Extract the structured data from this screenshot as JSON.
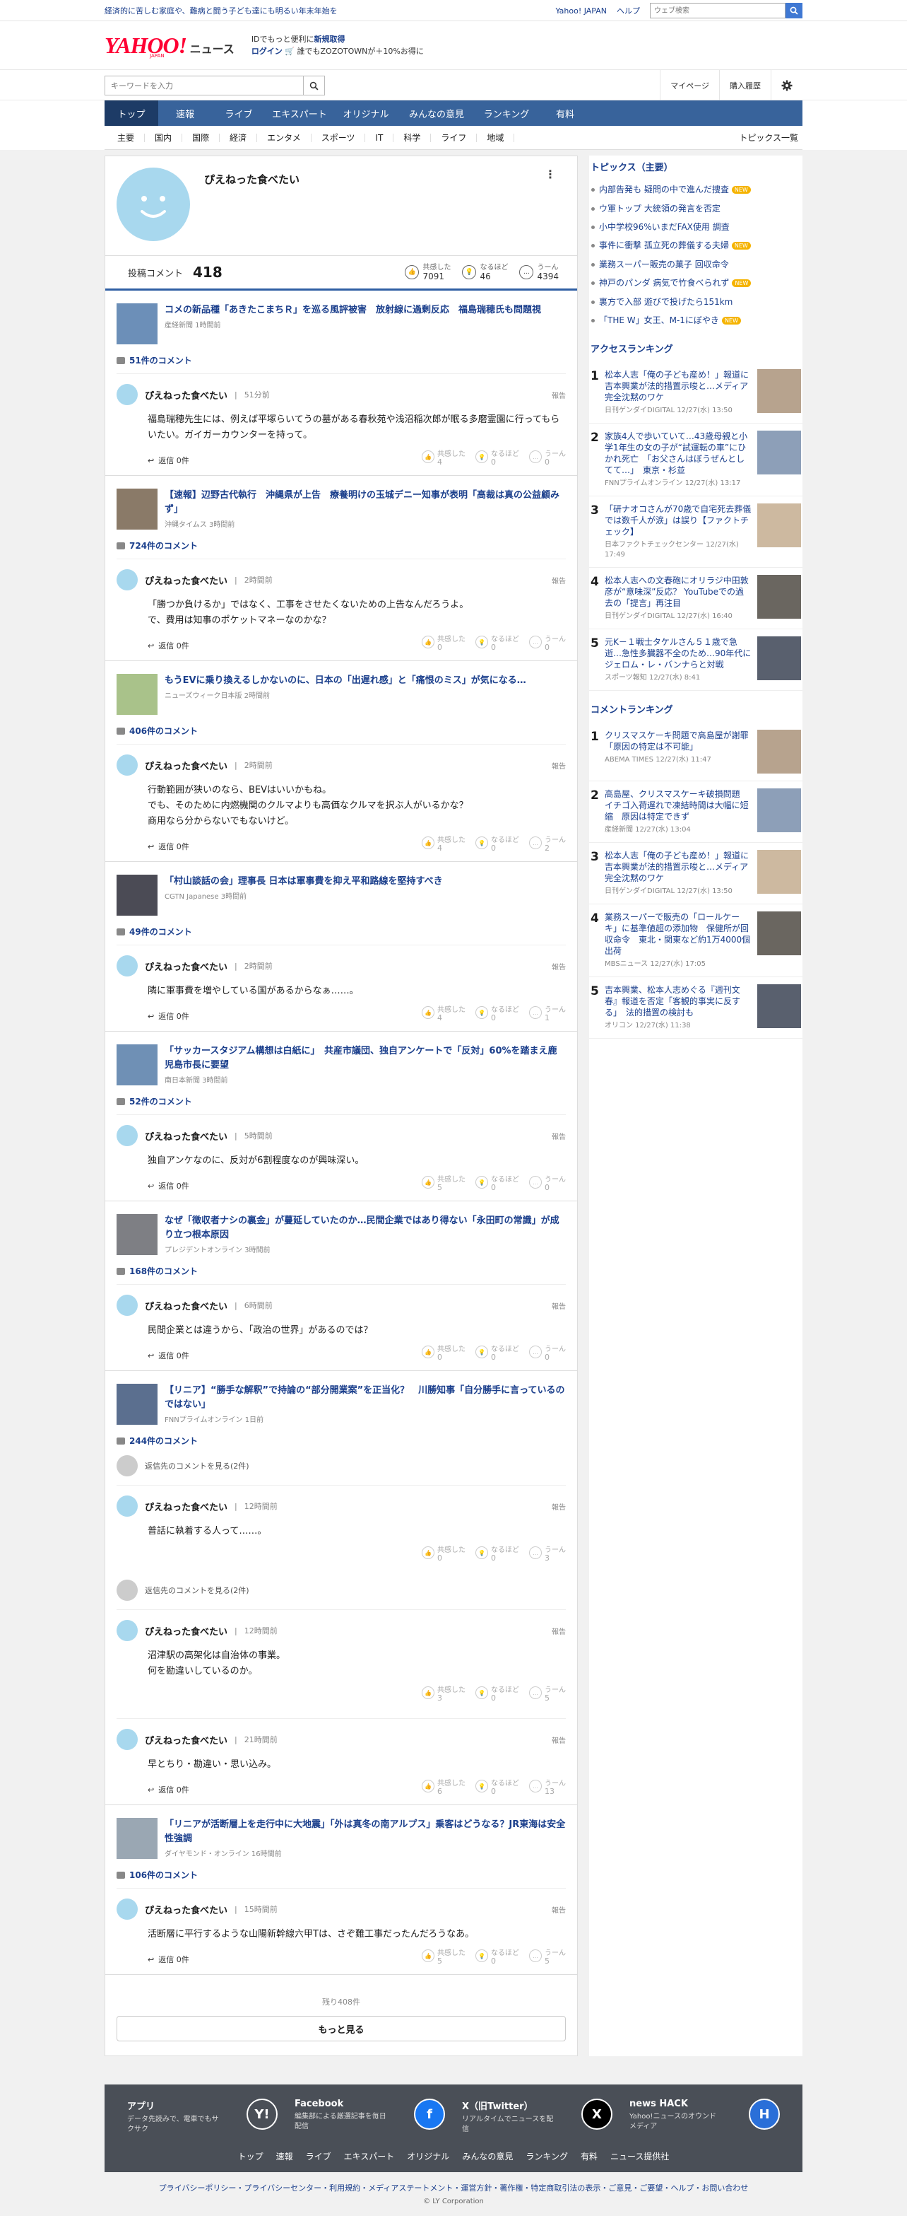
{
  "topstrip": {
    "promo": "経済的に苦しむ家庭や、難病と闘う子ども達にも明るい年末年始を",
    "links": [
      "Yahoo! JAPAN",
      "ヘルプ"
    ],
    "search_placeholder": "ウェブ検索"
  },
  "header": {
    "logo": "YAHOO!",
    "logo_sub": "JAPAN",
    "logo_news": "ニュース",
    "id_line1_a": "IDでもっと便利に",
    "id_line1_b": "新規取得",
    "id_line2_a": "ログイン",
    "id_line2_b": "🛒 誰でもZOZOTOWNが＋10%お得に"
  },
  "searchrow": {
    "placeholder": "キーワードを入力",
    "mypage": "マイページ",
    "purchase": "購入履歴"
  },
  "nav": {
    "tabs": [
      "トップ",
      "速報",
      "ライブ",
      "エキスパート",
      "オリジナル",
      "みんなの意見",
      "ランキング",
      "有料"
    ],
    "sub": [
      "主要",
      "国内",
      "国際",
      "経済",
      "エンタメ",
      "スポーツ",
      "IT",
      "科学",
      "ライフ",
      "地域"
    ],
    "sub_all": "トピックス一覧"
  },
  "profile": {
    "name": "ぴえねった食べたい",
    "post_label": "投稿コメント",
    "post_count": "418",
    "reactions": [
      {
        "label": "共感した",
        "count": "7091"
      },
      {
        "label": "なるほど",
        "count": "46"
      },
      {
        "label": "うーん",
        "count": "4394"
      }
    ]
  },
  "articles": [
    {
      "title": "コメの新品種「あきたこまちＲ」を巡る風評被害　放射線に過剰反応　福島瑞穂氏も問題視",
      "source": "産経新聞 1時間前",
      "comments_count": "51件のコメント",
      "comments": [
        {
          "user": "ぴえねった食べたい",
          "time": "51分前",
          "body": "福島瑞穂先生には、例えば平塚らいてうの墓がある春秋苑や浅沼稲次郎が眠る多磨霊園に行ってもらいたい。ガイガーカウンターを持って。",
          "reply": "返信 0件",
          "r": [
            "4",
            "0",
            "0"
          ]
        }
      ]
    },
    {
      "title": "【速報】辺野古代執行　沖縄県が上告　療養明けの玉城デニー知事が表明「高裁は真の公益顧みず」",
      "source": "沖縄タイムス 3時間前",
      "comments_count": "724件のコメント",
      "comments": [
        {
          "user": "ぴえねった食べたい",
          "time": "2時間前",
          "body": "「勝つか負けるか」ではなく、工事をさせたくないための上告なんだろうよ。\nで、費用は知事のポケットマネーなのかな？",
          "reply": "返信 0件",
          "r": [
            "0",
            "0",
            "0"
          ]
        }
      ]
    },
    {
      "title": "もうEVに乗り換えるしかないのに、日本の「出遅れ感」と「痛恨のミス」が気になる…",
      "source": "ニューズウィーク日本版 2時間前",
      "comments_count": "406件のコメント",
      "comments": [
        {
          "user": "ぴえねった食べたい",
          "time": "2時間前",
          "body": "行動範囲が狭いのなら、BEVはいいかもね。\nでも、そのために内燃機関のクルマよりも高価なクルマを択ぶ人がいるかな？\n商用なら分からないでもないけど。",
          "reply": "返信 0件",
          "r": [
            "4",
            "0",
            "2"
          ]
        }
      ]
    },
    {
      "title": "「村山談話の会」理事長 日本は軍事費を抑え平和路線を堅持すべき",
      "source": "CGTN Japanese 3時間前",
      "comments_count": "49件のコメント",
      "comments": [
        {
          "user": "ぴえねった食べたい",
          "time": "2時間前",
          "body": "隣に軍事費を増やしている国があるからなぁ……。",
          "reply": "返信 0件",
          "r": [
            "4",
            "0",
            "1"
          ]
        }
      ]
    },
    {
      "title": "「サッカースタジアム構想は白紙に」　共産市議団、独自アンケートで「反対」60%を踏まえ鹿児島市長に要望",
      "source": "南日本新聞 3時間前",
      "comments_count": "52件のコメント",
      "comments": [
        {
          "user": "ぴえねった食べたい",
          "time": "5時間前",
          "body": "独自アンケなのに、反対が6割程度なのが興味深い。",
          "reply": "返信 0件",
          "r": [
            "5",
            "0",
            "0"
          ]
        }
      ]
    },
    {
      "title": "なぜ「徴収者ナシの裏金」が蔓延していたのか…民間企業ではあり得ない「永田町の常識」が成り立つ根本原因",
      "source": "プレジデントオンライン 3時間前",
      "comments_count": "168件のコメント",
      "comments": [
        {
          "user": "ぴえねった食べたい",
          "time": "6時間前",
          "body": "民間企業とは違うから、「政治の世界」があるのでは？",
          "reply": "返信 0件",
          "r": [
            "0",
            "0",
            "0"
          ]
        }
      ]
    },
    {
      "title": "【リニア】“勝手な解釈”で持論の“部分開業案”を正当化？　川勝知事「自分勝手に言っているのではない」",
      "source": "FNNプライムオンライン 1日前",
      "comments_count": "244件のコメント",
      "threads": [
        {
          "see": "返信先のコメントを見る(2件)",
          "comment": {
            "user": "ぴえねった食べたい",
            "time": "12時間前",
            "body": "普話に執着する人って……。",
            "reply": "",
            "r": [
              "0",
              "0",
              "3"
            ]
          }
        },
        {
          "see": "返信先のコメントを見る(2件)",
          "comment": {
            "user": "ぴえねった食べたい",
            "time": "12時間前",
            "body": "沼津駅の高架化は自治体の事業。\n何を勘違いしているのか。",
            "reply": "",
            "r": [
              "3",
              "0",
              "5"
            ]
          }
        }
      ],
      "comments": [
        {
          "user": "ぴえねった食べたい",
          "time": "21時間前",
          "body": "早とちり・勘違い・思い込み。",
          "reply": "返信 0件",
          "r": [
            "6",
            "0",
            "13"
          ]
        }
      ]
    },
    {
      "title": "「リニアが活断層上を走行中に大地震」「外は真冬の南アルプス」乗客はどうなる？JR東海は安全性強調",
      "source": "ダイヤモンド・オンライン 16時間前",
      "comments_count": "106件のコメント",
      "comments": [
        {
          "user": "ぴえねった食べたい",
          "time": "15時間前",
          "body": "活断層に平行するような山陽新幹線六甲Tは、さぞ難工事だったんだろうなあ。",
          "reply": "返信 0件",
          "r": [
            "5",
            "0",
            "5"
          ]
        }
      ]
    }
  ],
  "labels": {
    "report": "報告",
    "kyokan": "共感した",
    "naruhodo": "なるほど",
    "uun": "うーん",
    "rest": "残り408件",
    "more": "もっと見る"
  },
  "topics": {
    "heading": "トピックス（主要）",
    "items": [
      {
        "t": "内部告発も 疑問の中で進んだ捜査",
        "new": true
      },
      {
        "t": "ウ軍トップ 大統領の発言を否定",
        "new": false
      },
      {
        "t": "小中学校96%いまだFAX使用 調査",
        "new": false
      },
      {
        "t": "事件に衝撃 孤立死の葬儀する夫婦",
        "new": true
      },
      {
        "t": "業務スーパー販売の菓子 回収命令",
        "new": false
      },
      {
        "t": "神戸のパンダ 病気で竹食べられず",
        "new": true
      },
      {
        "t": "裏方で入部 遊びで投げたら151km",
        "new": false
      },
      {
        "t": "「THE W」女王、M-1にぼやき",
        "new": true
      }
    ],
    "new_label": "NEW"
  },
  "access": {
    "heading": "アクセスランキング",
    "items": [
      {
        "n": "1",
        "t": "松本人志「俺の子ども産め！」報道に吉本興業が法的措置示唆と…メディア完全沈黙のワケ",
        "s": "日刊ゲンダイDIGITAL 12/27(水) 13:50"
      },
      {
        "n": "2",
        "t": "家族4人で歩いていて…43歳母親と小学1年生の女の子が“試運転の車”にひかれ死亡　「お父さんはぼうぜんとしてて…」　東京・杉並",
        "s": "FNNプライムオンライン 12/27(水) 13:17"
      },
      {
        "n": "3",
        "t": "「研ナオコさんが70歳で自宅死去葬儀では数千人が涙」は誤り【ファクトチェック】",
        "s": "日本ファクトチェックセンター 12/27(水) 17:49"
      },
      {
        "n": "4",
        "t": "松本人志への文春砲にオリラジ中田敦彦が“意味深”反応？ YouTubeでの過去の「提言」再注目",
        "s": "日刊ゲンダイDIGITAL 12/27(水) 16:40"
      },
      {
        "n": "5",
        "t": "元K－１戦士タケルさん５１歳で急逝…急性多臓器不全のため…90年代にジェロム・レ・バンナらと対戦",
        "s": "スポーツ報知 12/27(水) 8:41"
      }
    ]
  },
  "commentrank": {
    "heading": "コメントランキング",
    "items": [
      {
        "n": "1",
        "t": "クリスマスケーキ問題で高島屋が謝罪「原因の特定は不可能」",
        "s": "ABEMA TIMES 12/27(水) 11:47"
      },
      {
        "n": "2",
        "t": "高島屋、クリスマスケーキ破損問題　イチゴ入荷遅れで凍結時間は大幅に短縮　原因は特定できず",
        "s": "産経新聞 12/27(水) 13:04"
      },
      {
        "n": "3",
        "t": "松本人志「俺の子ども産め！」報道に吉本興業が法的措置示唆と…メディア完全沈黙のワケ",
        "s": "日刊ゲンダイDIGITAL 12/27(水) 13:50"
      },
      {
        "n": "4",
        "t": "業務スーパーで販売の「ロールケーキ」に基準値超の添加物　保健所が回収命令　東北・関東など約1万4000個出荷",
        "s": "MBSニュース 12/27(水) 17:05"
      },
      {
        "n": "5",
        "t": "吉本興業、松本人志めぐる『週刊文春』報道を否定「客観的事実に反する」　法的措置の検討も",
        "s": "オリコン 12/27(水) 11:38"
      }
    ]
  },
  "footer": {
    "apps": [
      {
        "name": "アプリ",
        "desc": "データ先読みで、電車でもサクサク",
        "icon": "Y!"
      },
      {
        "name": "Facebook",
        "desc": "編集部による厳選記事を毎日配信",
        "icon": "f"
      },
      {
        "name": "X（旧Twitter）",
        "desc": "リアルタイムでニュースを配信",
        "icon": "X"
      },
      {
        "name": "news HACK",
        "desc": "Yahoo!ニュースのオウンドメディア",
        "icon": "H"
      }
    ],
    "links": [
      "トップ",
      "速報",
      "ライブ",
      "エキスパート",
      "オリジナル",
      "みんなの意見",
      "ランキング",
      "有料",
      "ニュース提供社"
    ],
    "legal": "プライバシーポリシー・プライバシーセンター・利用規約・メディアステートメント・運営方針・著作権・特定商取引法の表示・ご意見・ご要望・ヘルプ・お問い合わせ",
    "copyright": "© LY Corporation"
  }
}
